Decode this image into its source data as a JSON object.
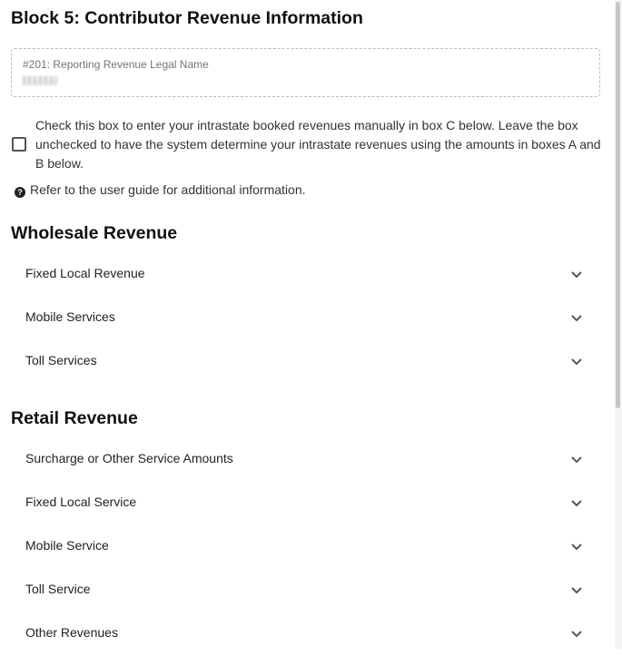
{
  "block_title": "Block 5: Contributor Revenue Information",
  "legal_name": {
    "label": "#201: Reporting Revenue Legal Name"
  },
  "manual_entry": {
    "checked": false,
    "text": "Check this box to enter your intrastate booked revenues manually in box C below. Leave the box unchecked to have the system determine your intrastate revenues using the amounts in boxes A and B below."
  },
  "guide_text": "Refer to the user guide for additional information.",
  "wholesale": {
    "title": "Wholesale Revenue",
    "items": [
      {
        "label": "Fixed Local Revenue"
      },
      {
        "label": "Mobile Services"
      },
      {
        "label": "Toll Services"
      }
    ]
  },
  "retail": {
    "title": "Retail Revenue",
    "items": [
      {
        "label": "Surcharge or Other Service Amounts"
      },
      {
        "label": "Fixed Local Service"
      },
      {
        "label": "Mobile Service"
      },
      {
        "label": "Toll Service"
      },
      {
        "label": "Other Revenues"
      }
    ]
  },
  "icons": {
    "help": "question-circle-icon",
    "expand": "chevron-down-icon"
  }
}
